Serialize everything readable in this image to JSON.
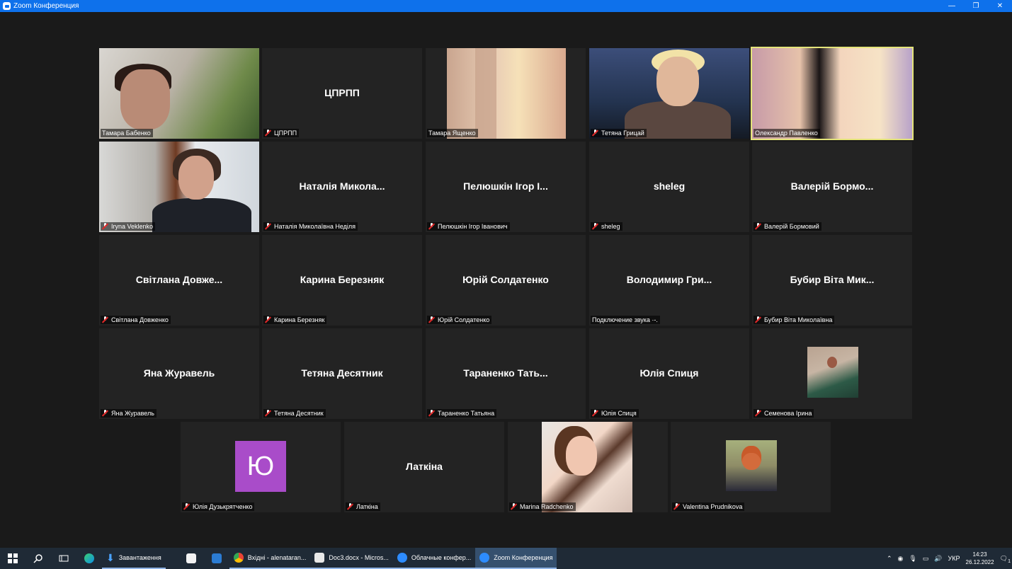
{
  "window": {
    "title": "Zoom Конференция",
    "minimize": "—",
    "restore": "❐",
    "close": "✕"
  },
  "tiles": [
    {
      "label": "Тамара Бабенко",
      "big": "",
      "muted": false
    },
    {
      "label": "ЦПРПП",
      "big": "ЦПРПП",
      "muted": true
    },
    {
      "label": "Тамара Ященко",
      "big": "",
      "muted": false
    },
    {
      "label": "Тетяна Грицай",
      "big": "",
      "muted": true
    },
    {
      "label": "Олександр Павленко",
      "big": "",
      "muted": false
    },
    {
      "label": "Iryna Veklenko",
      "big": "",
      "muted": true
    },
    {
      "label": "Наталія Миколаївна Неділя",
      "big": "Наталія Микола...",
      "muted": true
    },
    {
      "label": "Пелюшкін Ігор Іванович",
      "big": "Пелюшкін Ігор І...",
      "muted": true
    },
    {
      "label": "sheleg",
      "big": "sheleg",
      "muted": true
    },
    {
      "label": "Валерій Бормовий",
      "big": "Валерій Бормо...",
      "muted": true
    },
    {
      "label": "Світлана Довженко",
      "big": "Світлана Довже...",
      "muted": true
    },
    {
      "label": "Карина Березняк",
      "big": "Карина Березняк",
      "muted": true
    },
    {
      "label": "Юрій Солдатенко",
      "big": "Юрій Солдатенко",
      "muted": true
    },
    {
      "label": "Подключение звука ·-.",
      "big": "Володимир Гри...",
      "muted": false
    },
    {
      "label": "Бубир Віта Миколаївна",
      "big": "Бубир Віта Мик...",
      "muted": true
    },
    {
      "label": "Яна Журавель",
      "big": "Яна Журавель",
      "muted": true
    },
    {
      "label": "Тетяна Десятник",
      "big": "Тетяна Десятник",
      "muted": true
    },
    {
      "label": "Тараненко Татьяна",
      "big": "Тараненко Тать...",
      "muted": true
    },
    {
      "label": "Юлія Спиця",
      "big": "Юлія Спиця",
      "muted": true
    },
    {
      "label": "Семенова Ірина",
      "big": "",
      "muted": true
    },
    {
      "label": "Юлія Дузькрятченко",
      "big": "",
      "avatar_letter": "Ю",
      "muted": true
    },
    {
      "label": "Латкіна",
      "big": "Латкіна",
      "muted": true
    },
    {
      "label": "Marina Radchenko",
      "big": "",
      "muted": true
    },
    {
      "label": "Valentina Prudnikova",
      "big": "",
      "muted": true
    }
  ],
  "taskbar": {
    "apps": [
      {
        "label": "Завантаження"
      },
      {
        "label": "Вхідні - alenataran..."
      },
      {
        "label": "Doc3.docx - Micros..."
      },
      {
        "label": "Облачные конфер..."
      },
      {
        "label": "Zoom Конференция"
      }
    ],
    "language": "УКР",
    "time": "14:23",
    "date": "26.12.2022",
    "notifications": "1"
  },
  "colors": {
    "titlebar": "#0e71eb",
    "active_speaker_border": "#e4e47a",
    "taskbar": "#1f2a36",
    "avatar_purple": "#a94cc9"
  }
}
